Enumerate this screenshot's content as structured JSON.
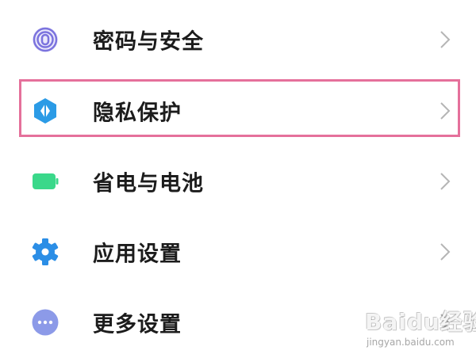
{
  "settings_items": [
    {
      "label": "密码与安全",
      "icon": "fingerprint-icon",
      "icon_color": "#7b73de"
    },
    {
      "label": "隐私保护",
      "icon": "privacy-shield-icon",
      "icon_color": "#2b9be6"
    },
    {
      "label": "省电与电池",
      "icon": "battery-icon",
      "icon_color": "#3ad88a"
    },
    {
      "label": "应用设置",
      "icon": "gear-icon",
      "icon_color": "#2b8ee6"
    },
    {
      "label": "更多设置",
      "icon": "more-dots-icon",
      "icon_color": "#8c9ae8"
    }
  ],
  "highlighted_item": "隐私保护",
  "highlight_color": "#e5709b",
  "watermark": {
    "logo_text": "Baidu经验",
    "url_text": "jingyan.baidu.com"
  }
}
